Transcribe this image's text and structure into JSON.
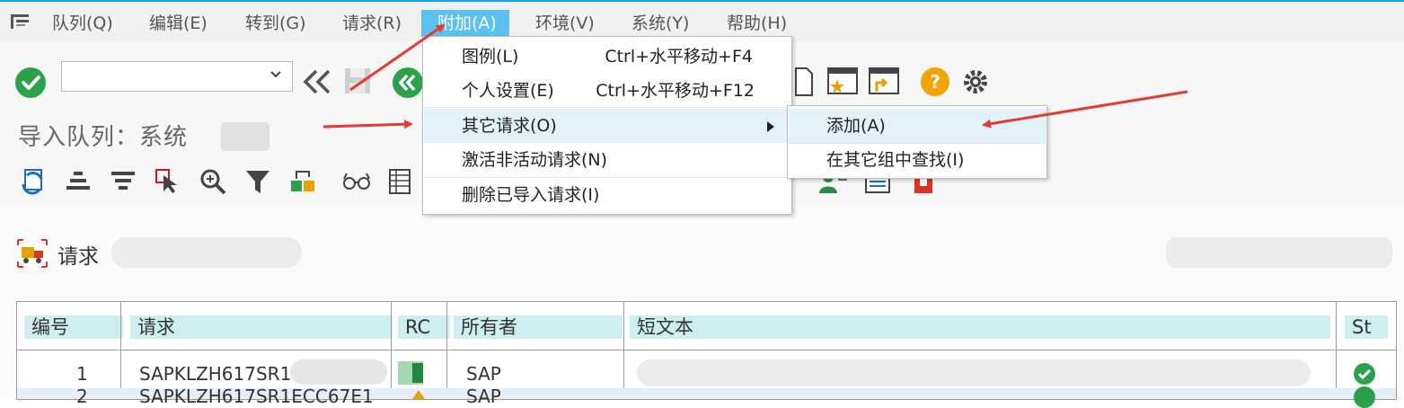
{
  "menubar": {
    "items": [
      {
        "label": "队列(Q)"
      },
      {
        "label": "编辑(E)"
      },
      {
        "label": "转到(G)"
      },
      {
        "label": "请求(R)"
      },
      {
        "label": "附加(A)"
      },
      {
        "label": "环境(V)"
      },
      {
        "label": "系统(Y)"
      },
      {
        "label": "帮助(H)"
      }
    ],
    "active_index": 4
  },
  "toolbar": {
    "command_field_value": ""
  },
  "page": {
    "title": "导入队列：系统"
  },
  "extras_menu": {
    "items": [
      {
        "label": "图例(L)",
        "shortcut": "Ctrl+水平移动+F4"
      },
      {
        "label": "个人设置(E)",
        "shortcut": "Ctrl+水平移动+F12"
      },
      {
        "label": "其它请求(O)",
        "shortcut": "",
        "has_submenu": true
      },
      {
        "label": "激活非活动请求(N)",
        "shortcut": ""
      },
      {
        "label": "删除已导入请求(I)",
        "shortcut": ""
      }
    ]
  },
  "submenu": {
    "items": [
      {
        "label": "添加(A)"
      },
      {
        "label": "在其它组中查找(I)"
      }
    ]
  },
  "section": {
    "label": "请求"
  },
  "table": {
    "columns": [
      "编号",
      "请求",
      "RC",
      "所有者",
      "短文本",
      "St"
    ],
    "rows": [
      {
        "number": "1",
        "request": "SAPKLZH617SR1",
        "owner": "SAP"
      },
      {
        "number": "2",
        "request": "SAPKLZH617SR1ECC67E1",
        "owner": "SAP"
      }
    ]
  },
  "colors": {
    "accent": "#59c2ef",
    "highlight": "#e3f1fb",
    "header_cell": "#cdeff2",
    "ok_green": "#2aa14a",
    "annotation_red": "#e53935"
  }
}
